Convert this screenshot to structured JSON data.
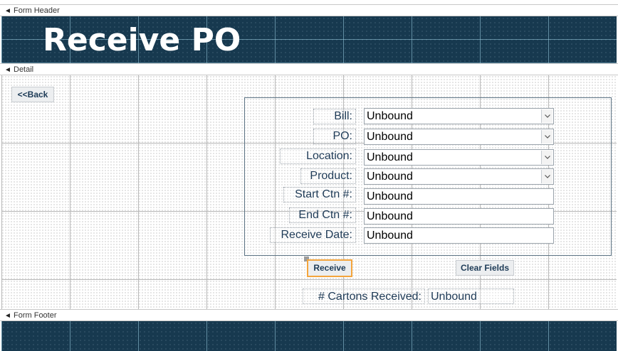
{
  "sections": {
    "form_header": "Form Header",
    "detail": "Detail",
    "form_footer": "Form Footer"
  },
  "header": {
    "title": "Receive PO"
  },
  "buttons": {
    "back": "<<Back",
    "receive": "Receive",
    "clear": "Clear Fields"
  },
  "fields": {
    "bill": {
      "label": "Bill:",
      "value": "Unbound",
      "type": "combo"
    },
    "po": {
      "label": "PO:",
      "value": "Unbound",
      "type": "combo"
    },
    "location": {
      "label": "Location:",
      "value": "Unbound",
      "type": "combo"
    },
    "product": {
      "label": "Product:",
      "value": "Unbound",
      "type": "combo"
    },
    "start_ctn": {
      "label": "Start Ctn #:",
      "value": "Unbound",
      "type": "text"
    },
    "end_ctn": {
      "label": "End Ctn #:",
      "value": "Unbound",
      "type": "text"
    },
    "receive_date": {
      "label": "Receive Date:",
      "value": "Unbound",
      "type": "text"
    }
  },
  "cartons": {
    "label": "# Cartons Received:",
    "value": "Unbound"
  },
  "icons": {
    "section_toggle": "section-collapse-icon",
    "dropdown": "chevron-down-icon"
  },
  "colors": {
    "band": "#17394f",
    "selection": "#f4a53d",
    "label_text": "#1f3b57"
  }
}
